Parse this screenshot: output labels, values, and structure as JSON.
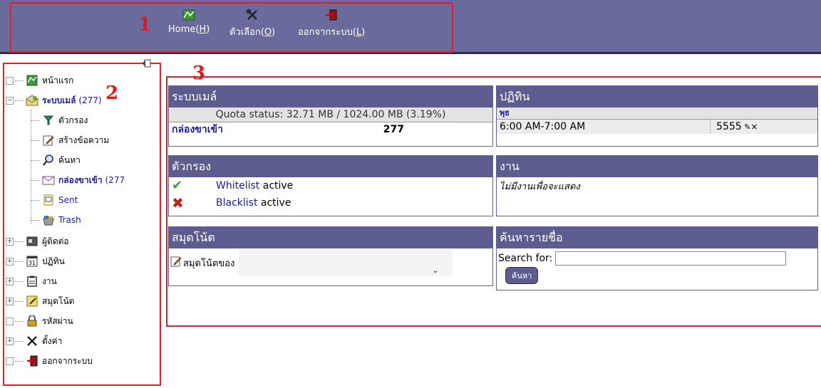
{
  "markers": [
    "1",
    "2",
    "3"
  ],
  "toolbar": {
    "home": {
      "label": "Home(",
      "key": "H",
      "end": ")"
    },
    "options": {
      "label": "ตัวเลือก(",
      "key": "O",
      "end": ")"
    },
    "logout": {
      "label": "ออกจากระบบ(",
      "key": "L",
      "end": ")"
    }
  },
  "sidebar": {
    "items": [
      {
        "label": "หน้าแรก",
        "icon": "home-map-icon"
      },
      {
        "label": "ระบบเมล์",
        "count": "(277)",
        "icon": "mail-system-icon"
      },
      {
        "label": "ตัวกรอง",
        "icon": "filter-icon"
      },
      {
        "label": "สร้างข้อความ",
        "icon": "compose-icon"
      },
      {
        "label": "ค้นหา",
        "icon": "search-icon"
      },
      {
        "label": "กล่องขาเข้า",
        "count": "(277",
        "icon": "envelope-icon"
      },
      {
        "label": "Sent",
        "icon": "sent-icon"
      },
      {
        "label": "Trash",
        "icon": "trash-icon"
      },
      {
        "label": "ผู้ติดต่อ",
        "icon": "contacts-icon"
      },
      {
        "label": "ปฏิทิน",
        "icon": "calendar-icon"
      },
      {
        "label": "งาน",
        "icon": "tasks-icon"
      },
      {
        "label": "สมุดโน้ต",
        "icon": "notepad-icon"
      },
      {
        "label": "รหัสผ่าน",
        "icon": "lock-icon"
      },
      {
        "label": "ตั้งค่า",
        "icon": "settings-icon"
      },
      {
        "label": "ออกจากระบบ",
        "icon": "logout-icon"
      }
    ]
  },
  "mail_panel": {
    "title": "ระบบเมล์",
    "quota": "Quota status: 32.71 MB / 1024.00 MB (3.19%)",
    "inbox_label": "กล่องขาเข้า",
    "inbox_count": "277"
  },
  "calendar_panel": {
    "title": "ปฏิทิน",
    "day": "พุธ",
    "time": "6:00 AM-7:00 AM",
    "event": "5555"
  },
  "filter_panel": {
    "title": "ตัวกรอง",
    "whitelist_link": "Whitelist",
    "whitelist_status": "active",
    "blacklist_link": "Blacklist",
    "blacklist_status": "active"
  },
  "tasks_panel": {
    "title": "งาน",
    "empty_text": "ไม่มีงานเพื่อจะแสดง"
  },
  "notes_panel": {
    "title": "สมุดโน้ต",
    "notes_label": "สมุดโน้ตของ"
  },
  "search_panel": {
    "title": "ค้นหารายชื่อ",
    "search_label": "Search for:",
    "search_value": "",
    "button": "ค้นหา"
  },
  "colors": {
    "topbar": "#6a6a9c",
    "panel_header": "#5c5c8e",
    "link": "#1a1a9a",
    "annotation_red": "#e0202a"
  }
}
